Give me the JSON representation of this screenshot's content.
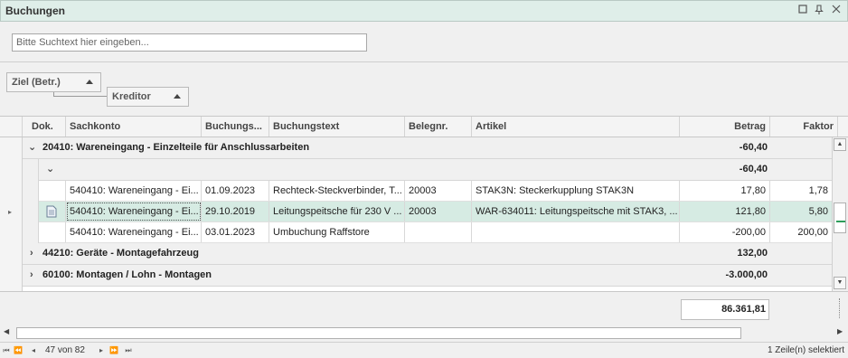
{
  "window": {
    "title": "Buchungen",
    "icons": [
      "maximize-icon",
      "pin-icon",
      "close-icon"
    ]
  },
  "search": {
    "placeholder": "Bitte Suchtext hier eingeben..."
  },
  "grouping": {
    "chip1": "Ziel (Betr.)",
    "chip2": "Kreditor"
  },
  "columns": {
    "dok": "Dok.",
    "sachkonto": "Sachkonto",
    "buchungsdatum": "Buchungs...",
    "buchungstext": "Buchungstext",
    "belegnr": "Belegnr.",
    "artikel": "Artikel",
    "betrag": "Betrag",
    "faktor": "Faktor"
  },
  "groups": [
    {
      "label": "20410: Wareneingang - Einzelteile für Anschlussarbeiten",
      "sum": "-60,40"
    },
    {
      "label": "",
      "sum": "-60,40"
    },
    {
      "label": "44210: Geräte - Montagefahrzeug",
      "sum": "132,00"
    },
    {
      "label": "60100: Montagen / Lohn - Montagen",
      "sum": "-3.000,00"
    }
  ],
  "rows": [
    {
      "sachkonto": "540410: Wareneingang - Ei...",
      "datum": "01.09.2023",
      "text": "Rechteck-Steckverbinder, T...",
      "beleg": "20003",
      "artikel": "STAK3N: Steckerkupplung STAK3N",
      "betrag": "17,80",
      "faktor": "1,78"
    },
    {
      "sachkonto": "540410: Wareneingang - Ei...",
      "datum": "29.10.2019",
      "text": "Leitungspeitsche für 230 V ...",
      "beleg": "20003",
      "artikel": "WAR-634011: Leitungspeitsche mit STAK3, ...",
      "betrag": "121,80",
      "faktor": "5,80"
    },
    {
      "sachkonto": "540410: Wareneingang - Ei...",
      "datum": "03.01.2023",
      "text": "Umbuchung Raffstore",
      "beleg": "",
      "artikel": "",
      "betrag": "-200,00",
      "faktor": "200,00"
    }
  ],
  "total": "86.361,81",
  "status": {
    "page": "47 von 82",
    "selection": "1 Zeile(n) selektiert"
  }
}
